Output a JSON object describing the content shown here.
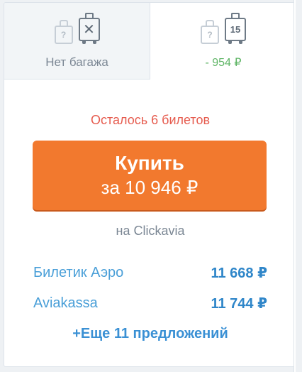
{
  "baggage_tabs": [
    {
      "hand_bag_glyph": "?",
      "suitcase_glyph": "✕",
      "label": "Нет багажа",
      "icons": [
        "hand-bag-icon",
        "suitcase-crossed-icon"
      ]
    },
    {
      "hand_bag_glyph": "?",
      "suitcase_glyph": "15",
      "price_diff": "- 954 ₽",
      "icons": [
        "hand-bag-icon",
        "suitcase-15kg-icon"
      ]
    }
  ],
  "offer": {
    "tickets_left": "Осталось 6 билетов",
    "buy_label": "Купить",
    "buy_price": "за 10 946 ₽",
    "seller": "на Clickavia"
  },
  "alternatives": [
    {
      "agency": "Билетик Аэро",
      "price": "11 668 ₽"
    },
    {
      "agency": "Aviakassa",
      "price": "11 744 ₽"
    }
  ],
  "more_offers": "+Еще 11 предложений",
  "colors": {
    "accent_button": "#f2792e",
    "warning_text": "#e65c4f",
    "discount_text": "#5fb566",
    "link": "#4a9fd8"
  }
}
